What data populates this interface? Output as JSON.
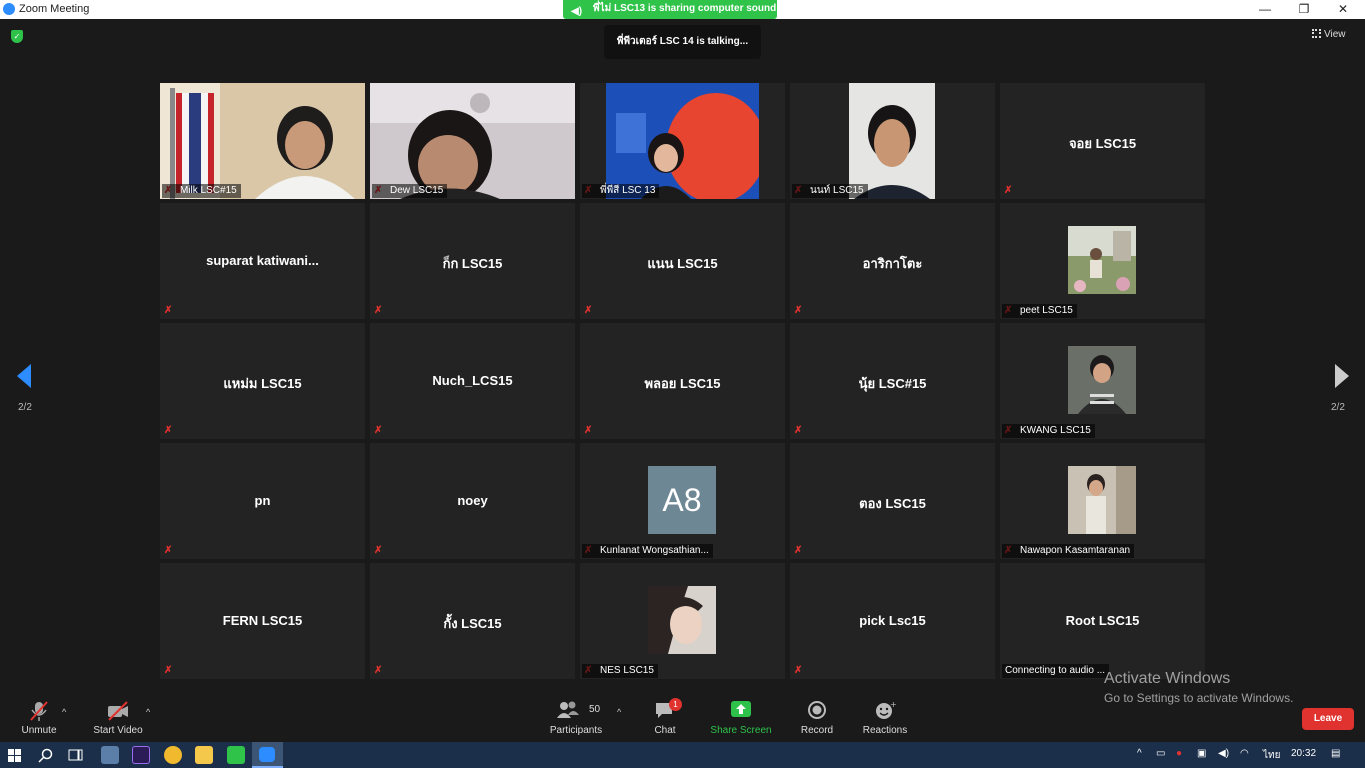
{
  "window": {
    "title": "Zoom Meeting",
    "minimize": "—",
    "maximize": "❐",
    "close": "✕"
  },
  "share_banner": "พี่ไม่ LSC13 is sharing computer sound",
  "talking": "พี่พีวเตอร์ LSC 14 is talking...",
  "view_label": "View",
  "page_label_left": "2/2",
  "page_label_right": "2/2",
  "tiles": [
    {
      "caption": "Milk LSC#15",
      "kind": "video"
    },
    {
      "caption": "Dew LSC15",
      "kind": "video"
    },
    {
      "caption": "พี่พีสี LSC 13",
      "kind": "video"
    },
    {
      "caption": "นนท์ LSC15",
      "kind": "video"
    },
    {
      "name": "จอย LSC15",
      "kind": "name"
    },
    {
      "name": "suparat  katiwani...",
      "kind": "name"
    },
    {
      "name": "ก็ก LSC15",
      "kind": "name"
    },
    {
      "name": "แนน  LSC15",
      "kind": "name"
    },
    {
      "name": "อาริกาโตะ",
      "kind": "name"
    },
    {
      "caption": "peet  LSC15",
      "kind": "photo"
    },
    {
      "name": "แหม่ม LSC15",
      "kind": "name"
    },
    {
      "name": "Nuch_LCS15",
      "kind": "name"
    },
    {
      "name": "พลอย LSC15",
      "kind": "name"
    },
    {
      "name": "นุ้ย LSC#15",
      "kind": "name"
    },
    {
      "caption": "KWANG LSC15",
      "kind": "photo"
    },
    {
      "name": "pn",
      "kind": "name"
    },
    {
      "name": "noey",
      "kind": "name"
    },
    {
      "caption": "Kunlanat Wongsathian...",
      "avatar": "A8",
      "kind": "initials"
    },
    {
      "name": "ตอง LSC15",
      "kind": "name"
    },
    {
      "caption": "Nawapon Kasamtaranan",
      "kind": "photo"
    },
    {
      "name": "FERN LSC15",
      "kind": "name"
    },
    {
      "name": "กั้ง LSC15",
      "kind": "name"
    },
    {
      "caption": "NES LSC15",
      "kind": "photo"
    },
    {
      "name": "pick Lsc15",
      "kind": "name"
    },
    {
      "name": "Root LSC15",
      "status": "Connecting to audio ...",
      "kind": "name"
    }
  ],
  "toolbar": {
    "unmute": "Unmute",
    "start_video": "Start Video",
    "participants": "Participants",
    "participants_count": "50",
    "chat": "Chat",
    "chat_badge": "1",
    "share_screen": "Share Screen",
    "record": "Record",
    "reactions": "Reactions",
    "leave": "Leave"
  },
  "watermark": {
    "line1": "Activate Windows",
    "line2": "Go to Settings to activate Windows."
  },
  "taskbar": {
    "time": "20:32",
    "lang": "ไทย"
  },
  "colors": {
    "accent": "#2d8cff",
    "share_green": "#30c34a",
    "leave_red": "#e0322e",
    "mute_red": "#e0322e"
  }
}
